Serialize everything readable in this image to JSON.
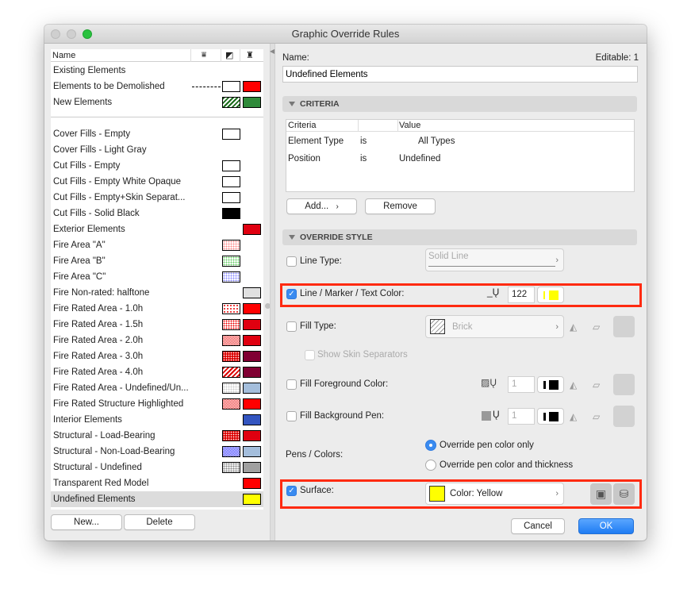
{
  "window": {
    "title": "Graphic Override Rules"
  },
  "list": {
    "header": {
      "name": "Name"
    },
    "groups": [
      [
        {
          "name": "Existing Elements"
        },
        {
          "name": "Elements to be Demolished",
          "line": "dashed",
          "sw1": "empty",
          "sw2": "#ff0000"
        },
        {
          "name": "New Elements",
          "sw1": "hatch-green",
          "sw2": "#2f8a3a"
        }
      ],
      [
        {
          "name": "Cover Fills - Empty",
          "sw1": "empty"
        },
        {
          "name": "Cover Fills - Light Gray"
        },
        {
          "name": "Cut Fills - Empty",
          "sw1": "empty"
        },
        {
          "name": "Cut Fills - Empty White Opaque",
          "sw1": "empty"
        },
        {
          "name": "Cut Fills - Empty+Skin Separat...",
          "sw1": "empty"
        },
        {
          "name": "Cut Fills - Solid Black",
          "sw1": "#000000"
        },
        {
          "name": "Exterior Elements",
          "sw2": "#e00010"
        },
        {
          "name": "Fire Area \"A\"",
          "sw1": "dots-pink"
        },
        {
          "name": "Fire Area \"B\"",
          "sw1": "dots-green"
        },
        {
          "name": "Fire Area \"C\"",
          "sw1": "dots-blue"
        },
        {
          "name": "Fire Non-rated: halftone",
          "sw2": "#e0e0e0"
        },
        {
          "name": "Fire Rated Area - 1.0h",
          "sw1": "dots-red-sparse",
          "sw2": "#ff0000"
        },
        {
          "name": "Fire Rated Area - 1.5h",
          "sw1": "dots-red",
          "sw2": "#e00010"
        },
        {
          "name": "Fire Rated Area - 2.0h",
          "sw1": "checks-red",
          "sw2": "#e00010"
        },
        {
          "name": "Fire Rated Area - 3.0h",
          "sw1": "dots-red-dense",
          "sw2": "#800033"
        },
        {
          "name": "Fire Rated Area - 4.0h",
          "sw1": "hatch-red",
          "sw2": "#800033"
        },
        {
          "name": "Fire Rated Area - Undefined/Un...",
          "sw1": "dots-gray-light",
          "sw2": "#a4bedc"
        },
        {
          "name": "Fire Rated Structure Highlighted",
          "sw1": "checks-red",
          "sw2": "#ff0000"
        },
        {
          "name": "Interior Elements",
          "sw2": "#3355c0"
        },
        {
          "name": "Structural - Load-Bearing",
          "sw1": "dots-red-dense",
          "sw2": "#e00010"
        },
        {
          "name": "Structural - Non-Load-Bearing",
          "sw1": "checks-blue",
          "sw2": "#a4bedc"
        },
        {
          "name": "Structural - Undefined",
          "sw1": "dots-gray",
          "sw2": "#a0a0a0"
        },
        {
          "name": "Transparent Red Model",
          "sw2": "#ff0000"
        },
        {
          "name": "Undefined Elements",
          "sw2": "#ffff00",
          "selected": true
        }
      ]
    ],
    "new_label": "New...",
    "delete_label": "Delete"
  },
  "detail": {
    "name_label": "Name:",
    "editable_label": "Editable: 1",
    "name_value": "Undefined Elements",
    "criteria": {
      "title": "CRITERIA",
      "columns": [
        "Criteria",
        "",
        "Value"
      ],
      "rows": [
        [
          "Element Type",
          "is",
          "All Types"
        ],
        [
          "Position",
          "is",
          "Undefined"
        ]
      ],
      "add_label": "Add...",
      "remove_label": "Remove"
    },
    "override": {
      "title": "OVERRIDE STYLE",
      "line_type": {
        "label": "Line Type:",
        "checked": false,
        "value": "Solid Line"
      },
      "line_color": {
        "label": "Line / Marker / Text Color:",
        "checked": true,
        "pen": "122",
        "color": "#ffff00"
      },
      "fill_type": {
        "label": "Fill Type:",
        "checked": false,
        "value": "Brick"
      },
      "skin": {
        "label": "Show Skin Separators",
        "checked": false
      },
      "fill_fg": {
        "label": "Fill Foreground Color:",
        "checked": false,
        "pen": "1"
      },
      "fill_bg": {
        "label": "Fill Background Pen:",
        "checked": false,
        "pen": "1"
      },
      "pens": {
        "label": "Pens / Colors:",
        "options": [
          "Override pen color only",
          "Override pen color and thickness"
        ],
        "selected": 0
      },
      "surface": {
        "label": "Surface:",
        "checked": true,
        "value": "Color: Yellow",
        "color": "#ffff00"
      }
    },
    "cancel_label": "Cancel",
    "ok_label": "OK"
  }
}
